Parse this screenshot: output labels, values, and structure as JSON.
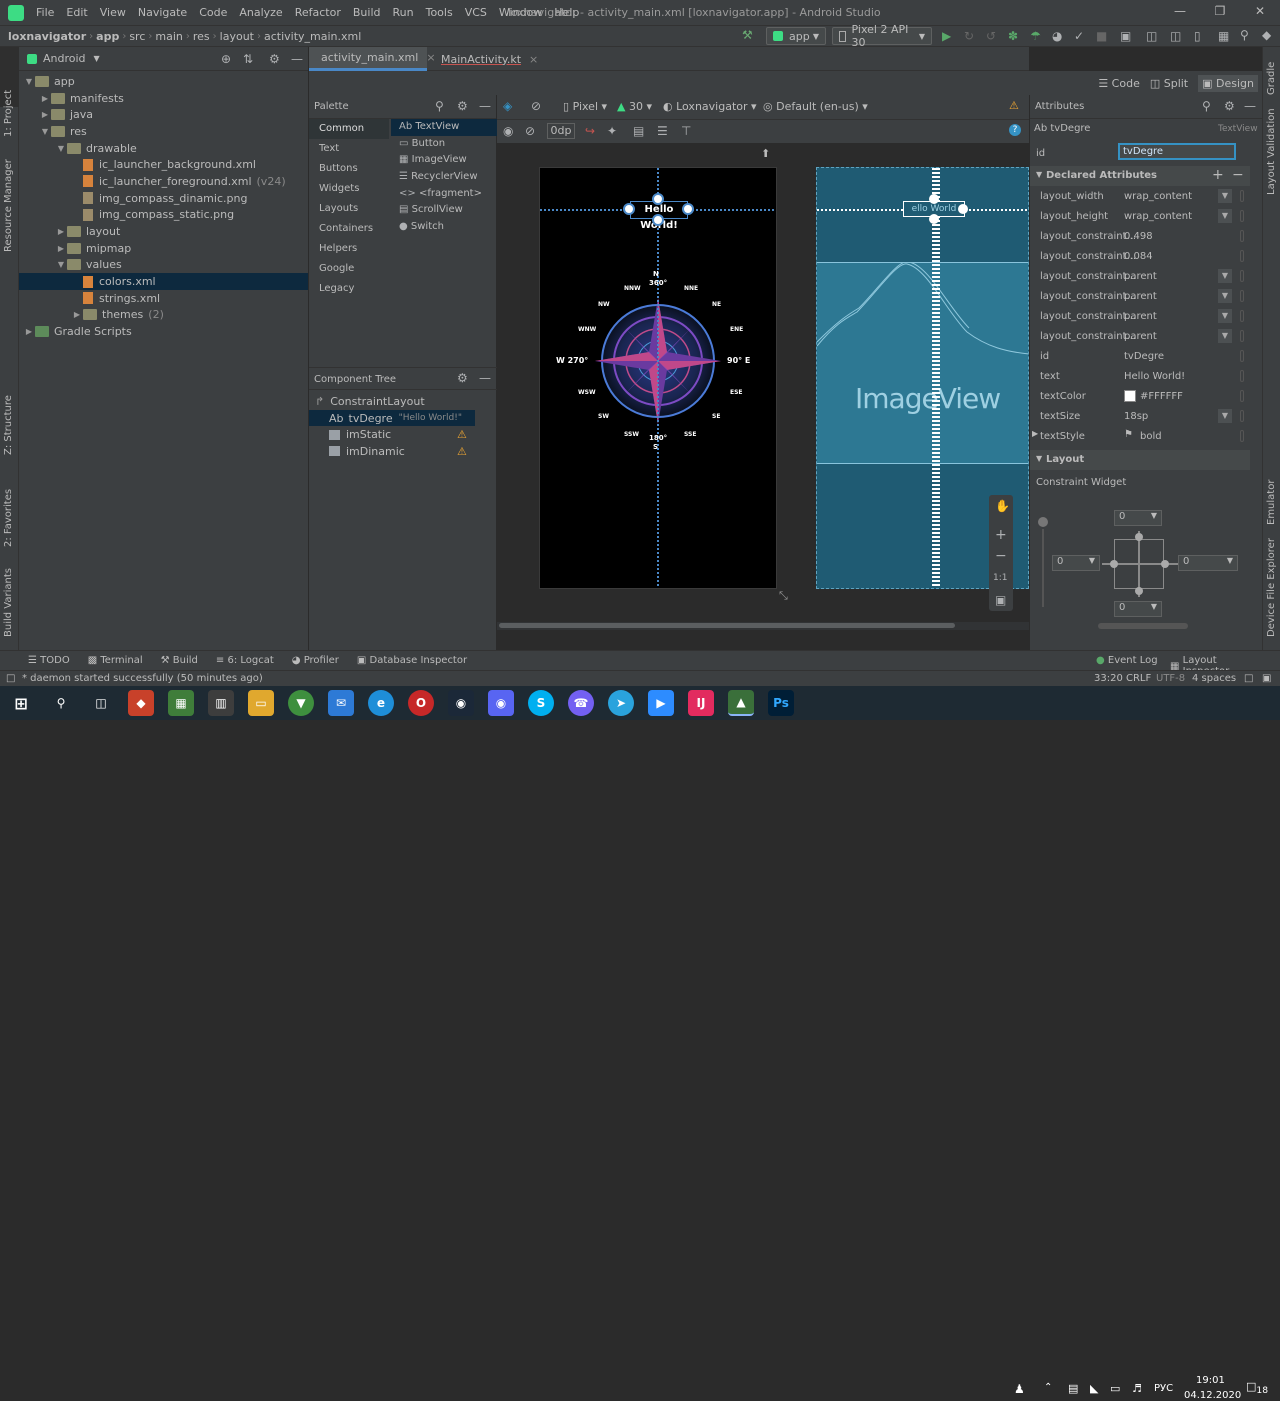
{
  "window": {
    "title": "loxnavigator - activity_main.xml [loxnavigator.app] - Android Studio"
  },
  "menu": [
    "File",
    "Edit",
    "View",
    "Navigate",
    "Code",
    "Analyze",
    "Refactor",
    "Build",
    "Run",
    "Tools",
    "VCS",
    "Window",
    "Help"
  ],
  "breadcrumbs": [
    "loxnavigator",
    "app",
    "src",
    "main",
    "res",
    "layout",
    "activity_main.xml"
  ],
  "toolbar": {
    "run_config": "app",
    "device": "Pixel 2 API 30"
  },
  "editor_tabs": [
    {
      "label": "activity_main.xml",
      "active": true
    },
    {
      "label": "MainActivity.kt",
      "active": false
    }
  ],
  "view_modes": [
    "Code",
    "Split",
    "Design"
  ],
  "project": {
    "view": "Android",
    "tree": [
      {
        "label": "app",
        "level": 0,
        "kind": "folder"
      },
      {
        "label": "manifests",
        "level": 1,
        "kind": "folder"
      },
      {
        "label": "java",
        "level": 1,
        "kind": "folder"
      },
      {
        "label": "res",
        "level": 1,
        "kind": "folder"
      },
      {
        "label": "drawable",
        "level": 2,
        "kind": "folder"
      },
      {
        "label": "ic_launcher_background.xml",
        "level": 3,
        "kind": "xml"
      },
      {
        "label": "ic_launcher_foreground.xml",
        "suffix": "(v24)",
        "level": 3,
        "kind": "xml"
      },
      {
        "label": "img_compass_dinamic.png",
        "level": 3,
        "kind": "png"
      },
      {
        "label": "img_compass_static.png",
        "level": 3,
        "kind": "png"
      },
      {
        "label": "layout",
        "level": 2,
        "kind": "folder"
      },
      {
        "label": "mipmap",
        "level": 2,
        "kind": "folder"
      },
      {
        "label": "values",
        "level": 2,
        "kind": "folder"
      },
      {
        "label": "colors.xml",
        "level": 3,
        "kind": "xml",
        "selected": true
      },
      {
        "label": "strings.xml",
        "level": 3,
        "kind": "xml"
      },
      {
        "label": "themes",
        "suffix": "(2)",
        "level": 3,
        "kind": "folder"
      },
      {
        "label": "Gradle Scripts",
        "level": 0,
        "kind": "gradle"
      }
    ]
  },
  "palette": {
    "title": "Palette",
    "categories": [
      "Common",
      "Text",
      "Buttons",
      "Widgets",
      "Layouts",
      "Containers",
      "Helpers",
      "Google",
      "Legacy"
    ],
    "widgets": [
      "TextView",
      "Button",
      "ImageView",
      "RecyclerView",
      "<fragment>",
      "ScrollView",
      "Switch"
    ]
  },
  "component_tree": {
    "title": "Component Tree",
    "root": "ConstraintLayout",
    "children": [
      {
        "label": "tvDegre",
        "extra": "\"Hello World!\"",
        "selected": true,
        "prefix": "Ab"
      },
      {
        "label": "imStatic",
        "warning": true
      },
      {
        "label": "imDinamic",
        "warning": true
      }
    ]
  },
  "design_toolbar": {
    "device": "Pixel",
    "api": "30",
    "theme": "Loxnavigator",
    "locale": "Default (en-us)",
    "margin": "0dp"
  },
  "canvas": {
    "hello_text": "Hello World!",
    "compass": {
      "north": "N",
      "north_deg": "360°",
      "east": "90° E",
      "west": "W 270°",
      "south": "S",
      "south_deg": "180°"
    },
    "blueprint_label": "ImageView",
    "blueprint_text": "ello World"
  },
  "attributes": {
    "title": "Attributes",
    "component": "tvDegre",
    "component_type": "TextView",
    "id_label": "id",
    "id_value": "tvDegre",
    "declared_title": "Declared Attributes",
    "rows": [
      {
        "name": "layout_width",
        "value": "wrap_content",
        "dd": true
      },
      {
        "name": "layout_height",
        "value": "wrap_content",
        "dd": true
      },
      {
        "name": "layout_constraint...",
        "value": "0.498"
      },
      {
        "name": "layout_constraint...",
        "value": "0.084"
      },
      {
        "name": "layout_constraint...",
        "value": "parent",
        "dd": true
      },
      {
        "name": "layout_constraint...",
        "value": "parent",
        "dd": true
      },
      {
        "name": "layout_constraint...",
        "value": "parent",
        "dd": true
      },
      {
        "name": "layout_constraint...",
        "value": "parent",
        "dd": true
      },
      {
        "name": "id",
        "value": "tvDegre"
      },
      {
        "name": "text",
        "value": "Hello World!"
      },
      {
        "name": "textColor",
        "value": "#FFFFFF",
        "swatch": "#FFFFFF"
      },
      {
        "name": "textSize",
        "value": "18sp",
        "dd": true
      },
      {
        "name": "textStyle",
        "value": "bold",
        "flag": true
      }
    ],
    "layout_title": "Layout",
    "constraint_widget": "Constraint Widget",
    "margins": {
      "top": "0",
      "left": "0",
      "right": "0",
      "bottom": "0"
    }
  },
  "left_strip": [
    "1: Project",
    "Resource Manager",
    "Z: Structure",
    "2: Favorites",
    "Build Variants"
  ],
  "right_strip": [
    "Gradle",
    "Layout Validation",
    "Emulator",
    "Device File Explorer"
  ],
  "tool_windows": [
    {
      "label": "TODO"
    },
    {
      "label": "Terminal"
    },
    {
      "label": "Build"
    },
    {
      "label": "6: Logcat"
    },
    {
      "label": "Profiler"
    },
    {
      "label": "Database Inspector"
    }
  ],
  "tool_windows_right": [
    "Event Log",
    "Layout Inspector"
  ],
  "status": {
    "message": "* daemon started successfully (50 minutes ago)",
    "position": "33:20",
    "line_sep": "CRLF",
    "encoding": "UTF-8",
    "indent": "4 spaces"
  },
  "taskbar": {
    "lang": "РУС",
    "time": "19:01",
    "date": "04.12.2020",
    "notif": "18"
  },
  "colors": {
    "accent": "#3592c4",
    "selection": "#0d293e",
    "blueprint": "#1f5b73",
    "warning": "#f0a732"
  }
}
